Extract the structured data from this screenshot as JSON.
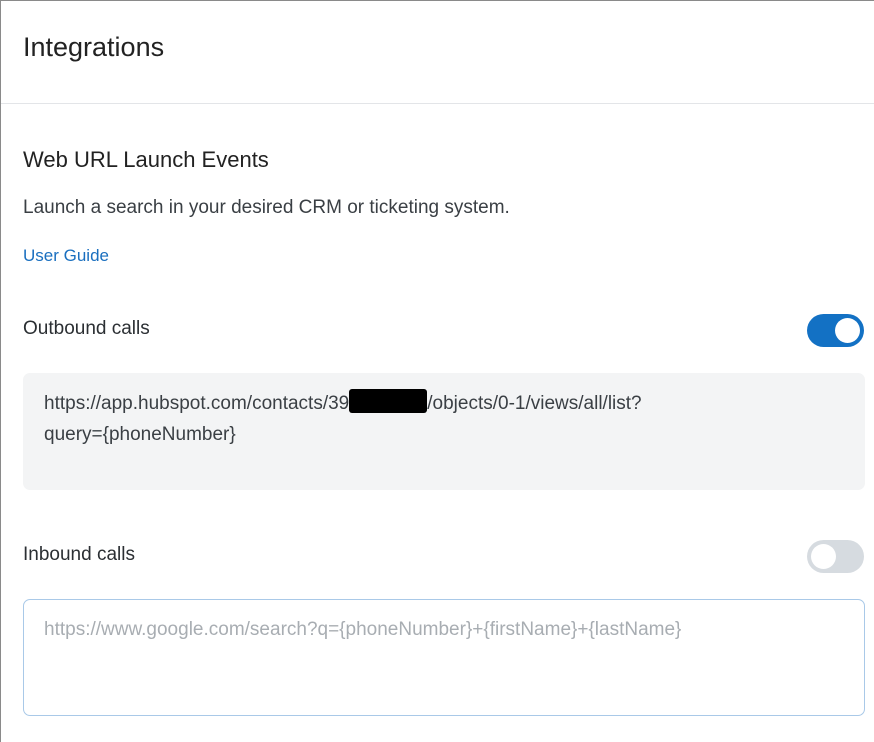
{
  "header": {
    "title": "Integrations"
  },
  "section": {
    "title": "Web URL Launch Events",
    "description": "Launch a search in your desired CRM or ticketing system.",
    "link_label": "User Guide"
  },
  "outbound": {
    "label": "Outbound calls",
    "enabled": true,
    "url_prefix": "https://app.hubspot.com/contacts/39",
    "url_suffix": "/objects/0-1/views/all/list?",
    "url_line2": "query={phoneNumber}"
  },
  "inbound": {
    "label": "Inbound calls",
    "enabled": false,
    "placeholder": "https://www.google.com/search?q={phoneNumber}+{firstName}+{lastName}"
  },
  "colors": {
    "accent": "#1371c4",
    "link": "#1a6fbf",
    "toggle_off": "#d6dbe0",
    "input_border": "#a9c9e8",
    "field_bg": "#f3f4f5"
  },
  "icons": {
    "redaction": "redacted-block"
  }
}
